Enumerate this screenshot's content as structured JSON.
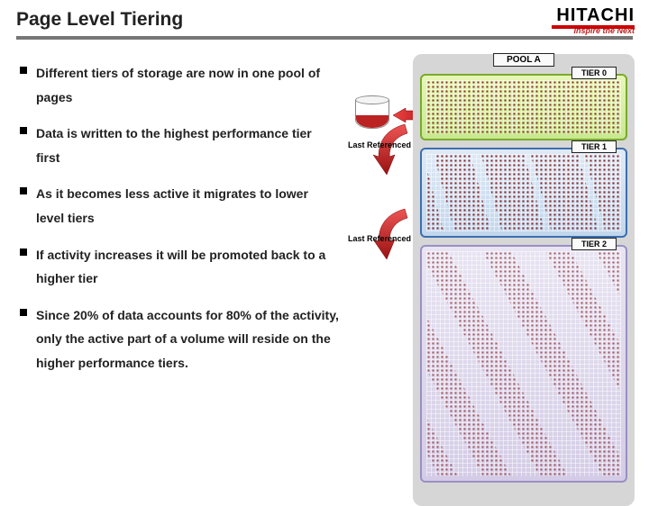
{
  "header": {
    "title": "Page Level Tiering",
    "logo_main": "HITACHI",
    "logo_tag": "Inspire the Next"
  },
  "bullets": [
    "Different tiers of storage are now in one pool of pages",
    "Data is written to the highest performance tier first",
    "As it becomes less active it migrates to lower level tiers",
    "If activity increases it will be promoted back to a higher tier",
    "Since 20% of data accounts for 80% of the activity, only the active part of a volume will reside on the higher performance tiers."
  ],
  "pool": {
    "label": "POOL A",
    "tiers": [
      {
        "label": "TIER 0"
      },
      {
        "label": "TIER 1"
      },
      {
        "label": "TIER 2"
      }
    ],
    "ref_label": "Last Referenced"
  }
}
